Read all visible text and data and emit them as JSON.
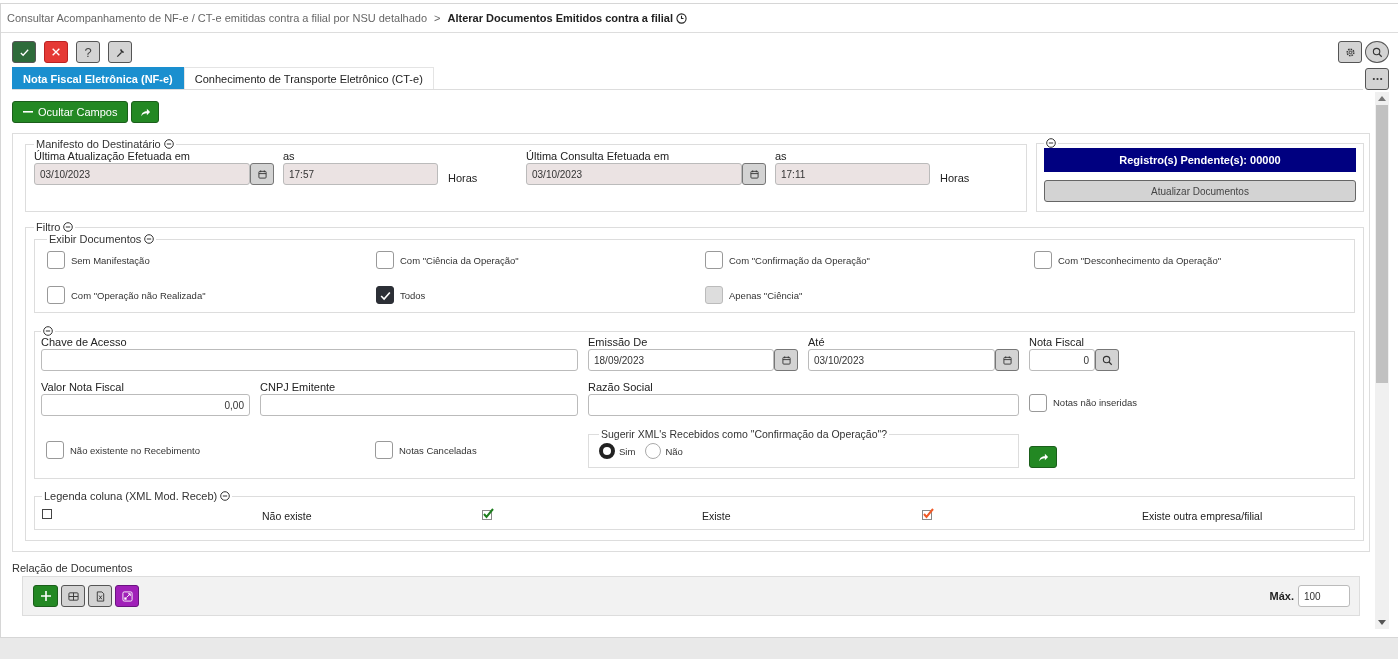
{
  "breadcrumb": {
    "parent": "Consultar Acompanhamento de NF-e / CT-e emitidas contra a filial por NSU detalhado",
    "separator": ">",
    "current": "Alterar Documentos Emitidos contra a filial"
  },
  "toolbar": [
    {
      "kind": "confirm"
    },
    {
      "kind": "cancel"
    },
    {
      "kind": "help",
      "glyph": "?"
    },
    {
      "kind": "tools"
    }
  ],
  "tabs": [
    {
      "label": "Nota Fiscal Eletrônica (NF-e)",
      "selected": true
    },
    {
      "label": "Conhecimento de Transporte Eletrônico (CT-e)",
      "selected": false
    }
  ],
  "actions": {
    "hide_fields": "Ocultar Campos"
  },
  "manifest": {
    "legend": "Manifesto do Destinatário",
    "groups": [
      {
        "label": "Última Atualização Efetuada em",
        "date": "03/10/2023",
        "time_label": "as",
        "time": "17:57",
        "unit": "Horas"
      },
      {
        "label": "Última Consulta Efetuada em",
        "date": "03/10/2023",
        "time_label": "as",
        "time": "17:11",
        "unit": "Horas"
      }
    ]
  },
  "pending": {
    "status": "Registro(s) Pendente(s): 00000",
    "button": "Atualizar Documentos"
  },
  "filter": {
    "legend": "Filtro",
    "show_documents": {
      "legend": "Exibir Documentos",
      "options": [
        {
          "label": "Sem Manifestação",
          "checked": false,
          "disabled": false
        },
        {
          "label": "Com \"Ciência da Operação\"",
          "checked": false,
          "disabled": false
        },
        {
          "label": "Com \"Confirmação da Operação\"",
          "checked": false,
          "disabled": false
        },
        {
          "label": "Com \"Desconhecimento da Operação\"",
          "checked": false,
          "disabled": false
        },
        {
          "label": "Com \"Operação não Realizada\"",
          "checked": false,
          "disabled": false
        },
        {
          "label": "Todos",
          "checked": true,
          "disabled": false
        },
        {
          "label": "Apenas \"Ciência\"",
          "checked": false,
          "disabled": true
        }
      ]
    },
    "search": {
      "access_key": {
        "label": "Chave de Acesso"
      },
      "issued_from": {
        "label": "Emissão De",
        "value": "18/09/2023"
      },
      "issued_to": {
        "label": "Até",
        "value": "03/10/2023"
      },
      "invoice": {
        "label": "Nota Fiscal",
        "value": "0"
      },
      "amount": {
        "label": "Valor Nota Fiscal",
        "value": "0,00"
      },
      "cnpj": {
        "label": "CNPJ Emitente"
      },
      "company": {
        "label": "Razão Social"
      },
      "not_inserted": {
        "label": "Notas não inseridas",
        "checked": false
      },
      "not_received": {
        "label": "Não existente no Recebimento",
        "checked": false
      },
      "cancelled": {
        "label": "Notas Canceladas",
        "checked": false
      },
      "suggest": {
        "legend": "Sugerir XML's Recebidos como \"Confirmação da Operação\"?",
        "options": [
          {
            "label": "Sim",
            "selected": true
          },
          {
            "label": "Não",
            "selected": false
          }
        ]
      }
    },
    "column_legend": {
      "legend": "Legenda coluna (XML Mod. Receb)",
      "items": [
        {
          "kind": "empty",
          "label": "Não existe"
        },
        {
          "kind": "exists",
          "label": "Existe"
        },
        {
          "kind": "other",
          "label": "Existe outra empresa/filial"
        }
      ]
    }
  },
  "documents": {
    "title": "Relação de Documentos",
    "max_label": "Máx.",
    "max_value": "100"
  }
}
